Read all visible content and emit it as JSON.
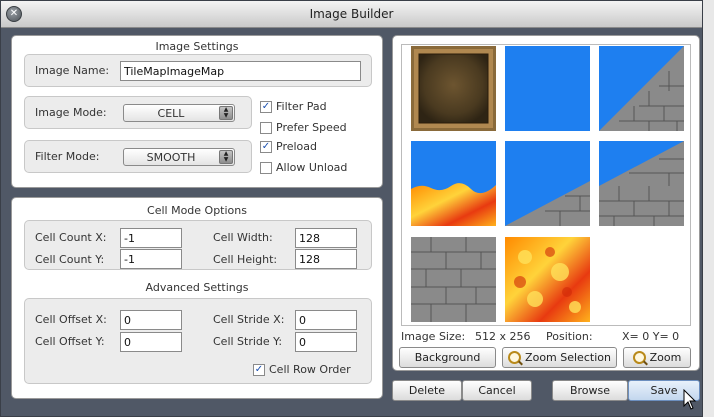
{
  "window": {
    "title": "Image Builder"
  },
  "image_settings": {
    "title": "Image Settings",
    "image_name_label": "Image Name:",
    "image_name_value": "TileMapImageMap",
    "image_mode_label": "Image Mode:",
    "image_mode_value": "CELL",
    "filter_mode_label": "Filter Mode:",
    "filter_mode_value": "SMOOTH",
    "checkboxes": [
      {
        "label": "Filter Pad",
        "checked": true
      },
      {
        "label": "Prefer Speed",
        "checked": false
      },
      {
        "label": "Preload",
        "checked": true
      },
      {
        "label": "Allow Unload",
        "checked": false
      }
    ]
  },
  "cell_mode": {
    "title": "Cell Mode Options",
    "cell_count_x_label": "Cell Count X:",
    "cell_count_x_value": "-1",
    "cell_count_y_label": "Cell Count Y:",
    "cell_count_y_value": "-1",
    "cell_width_label": "Cell Width:",
    "cell_width_value": "128",
    "cell_height_label": "Cell Height:",
    "cell_height_value": "128"
  },
  "advanced": {
    "title": "Advanced Settings",
    "cell_offset_x_label": "Cell Offset X:",
    "cell_offset_x_value": "0",
    "cell_offset_y_label": "Cell Offset Y:",
    "cell_offset_y_value": "0",
    "cell_stride_x_label": "Cell Stride X:",
    "cell_stride_x_value": "0",
    "cell_stride_y_label": "Cell Stride Y:",
    "cell_stride_y_value": "0",
    "row_order_label": "Cell Row Order",
    "row_order_checked": true
  },
  "preview": {
    "image_size_label": "Image Size:",
    "image_size_value": "512 x 256",
    "position_label": "Position:",
    "position_value": "X= 0 Y= 0",
    "background_button": "Background",
    "zoom_selection_button": "Zoom Selection",
    "zoom_button": "Zoom"
  },
  "footer": {
    "delete": "Delete",
    "cancel": "Cancel",
    "browse": "Browse",
    "save": "Save"
  },
  "colors": {
    "sky": "#1e7ff0",
    "window_bg": "#505866"
  }
}
